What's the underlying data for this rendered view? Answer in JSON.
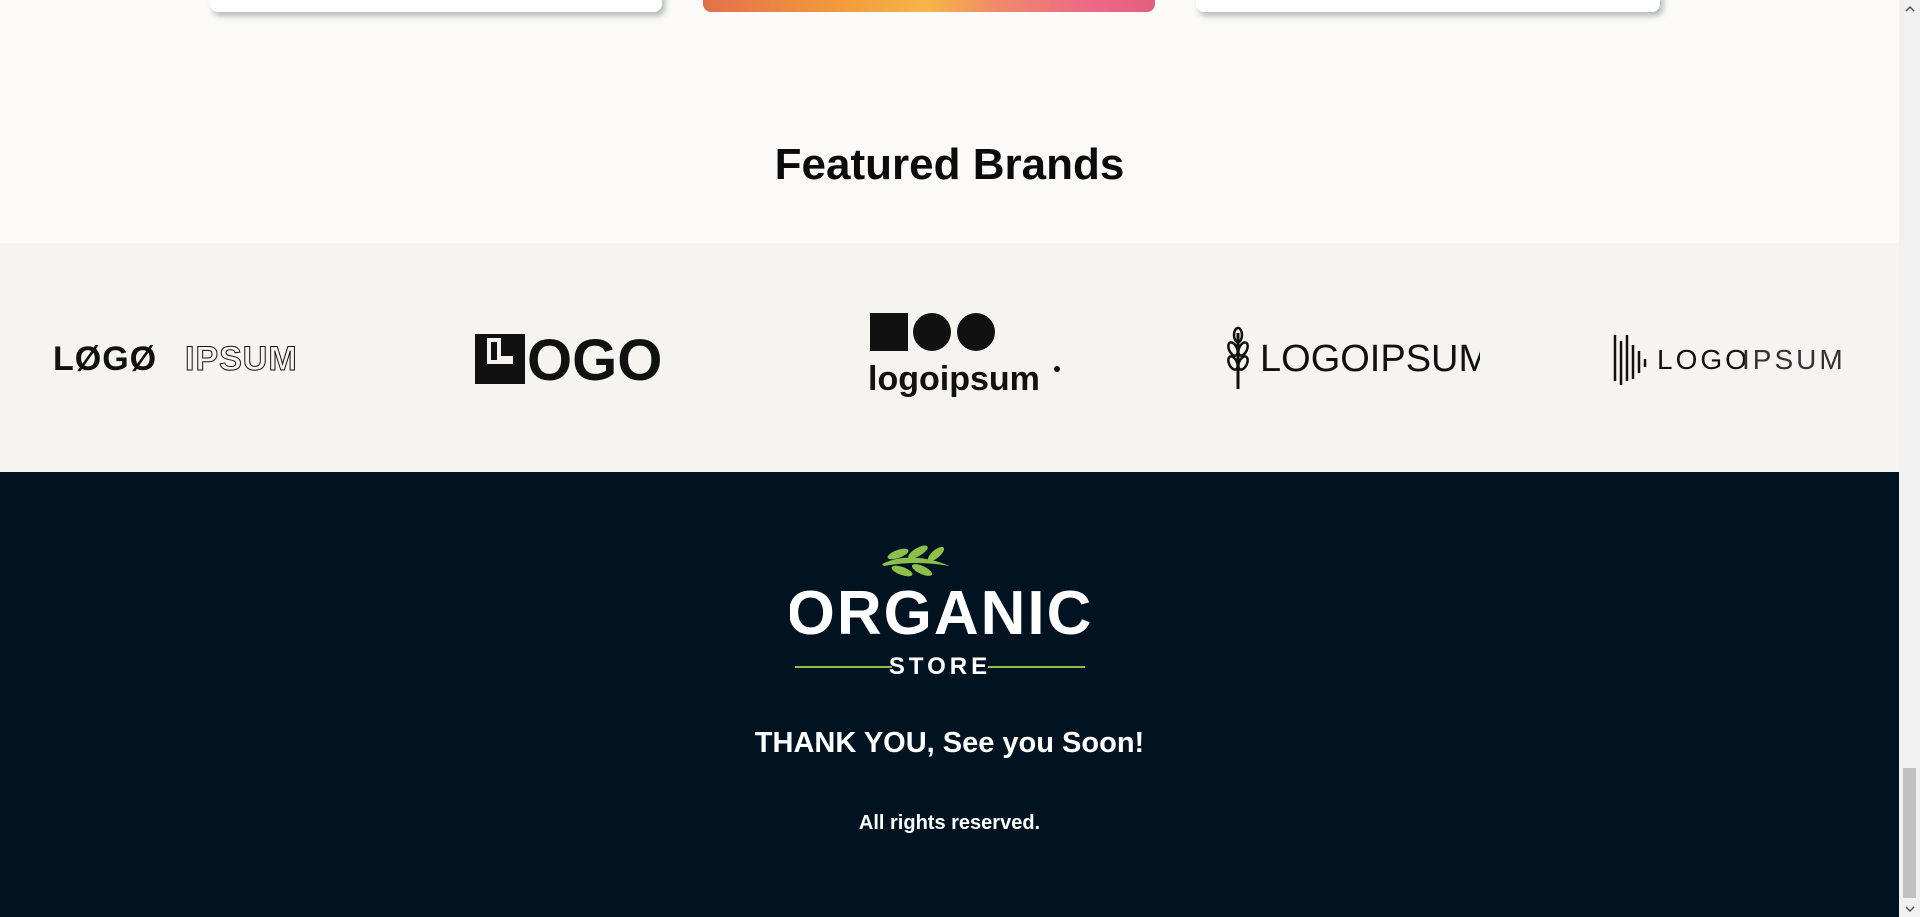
{
  "featured": {
    "title": "Featured Brands"
  },
  "brands": [
    {
      "name": "LØGØIPSUM",
      "part1": "LØGØ",
      "part2": "IPSUM"
    },
    {
      "name": "LOGO",
      "text": "OGO"
    },
    {
      "name": "logoipsum",
      "text": "logoipsum"
    },
    {
      "name": "LOGOIPSUM",
      "text": "LOGOIPSUM"
    },
    {
      "name": "LOGOIPSUM",
      "part1": "LOGO",
      "part2": "IPSUM"
    }
  ],
  "footer": {
    "logo_main": "ORGANIC",
    "logo_sub": "STORE",
    "thank_you": "THANK YOU, See you Soon!",
    "rights": "All rights reserved."
  },
  "colors": {
    "page_bg": "#fbfaf8",
    "brands_bg": "#f5f4f1",
    "footer_bg": "#011321",
    "leaf_green": "#8cc04a"
  }
}
